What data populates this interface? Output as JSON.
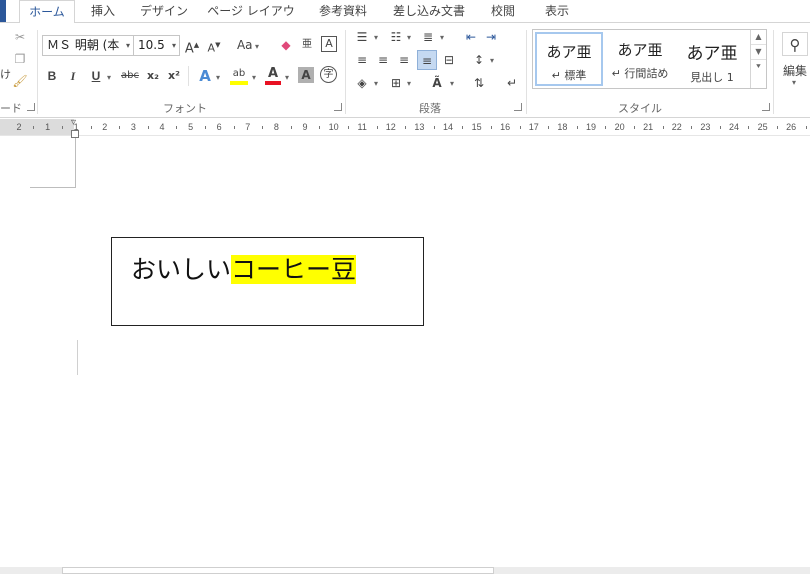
{
  "tabs": [
    "ホーム",
    "挿入",
    "デザイン",
    "ページ レイアウト",
    "参考資料",
    "差し込み文書",
    "校閲",
    "表示"
  ],
  "active_tab": "ホーム",
  "groups": {
    "clipboard_label_partial": "ード",
    "font_label": "フォント",
    "paragraph_label": "段落",
    "styles_label": "スタイル",
    "editing_label": "編集"
  },
  "font": {
    "name": "ＭＳ 明朝 (本",
    "size": "10.5",
    "grow": "A",
    "shrink": "A",
    "change_case": "Aa",
    "phonetic": "亜",
    "enclosed": "A",
    "bold": "B",
    "italic": "I",
    "underline": "U",
    "strike": "abc",
    "subscript": "x₂",
    "superscript": "x²",
    "effects": "A",
    "highlight": "ab",
    "color": "A",
    "shading": "A",
    "enclose_char": "字"
  },
  "colors": {
    "tab_accent": "#2b579a",
    "highlight_yellow": "#ffff00",
    "font_red": "#e81123",
    "style_selected_border": "#a6c8ee"
  },
  "styles": [
    {
      "sample": "あア亜",
      "name": "↵ 標準"
    },
    {
      "sample": "あア亜",
      "name": "↵ 行間詰め"
    },
    {
      "sample": "あア亜",
      "name": "見出し 1"
    }
  ],
  "ruler_numbers": [
    "2",
    "1",
    "1",
    "2",
    "3",
    "4",
    "5",
    "6",
    "7",
    "8",
    "9",
    "10",
    "11",
    "12",
    "13",
    "14",
    "15",
    "16",
    "17",
    "18",
    "19",
    "20",
    "21",
    "22",
    "23",
    "24",
    "25",
    "26"
  ],
  "document": {
    "text_plain": "おいしい",
    "text_highlighted": "コーヒー豆"
  }
}
